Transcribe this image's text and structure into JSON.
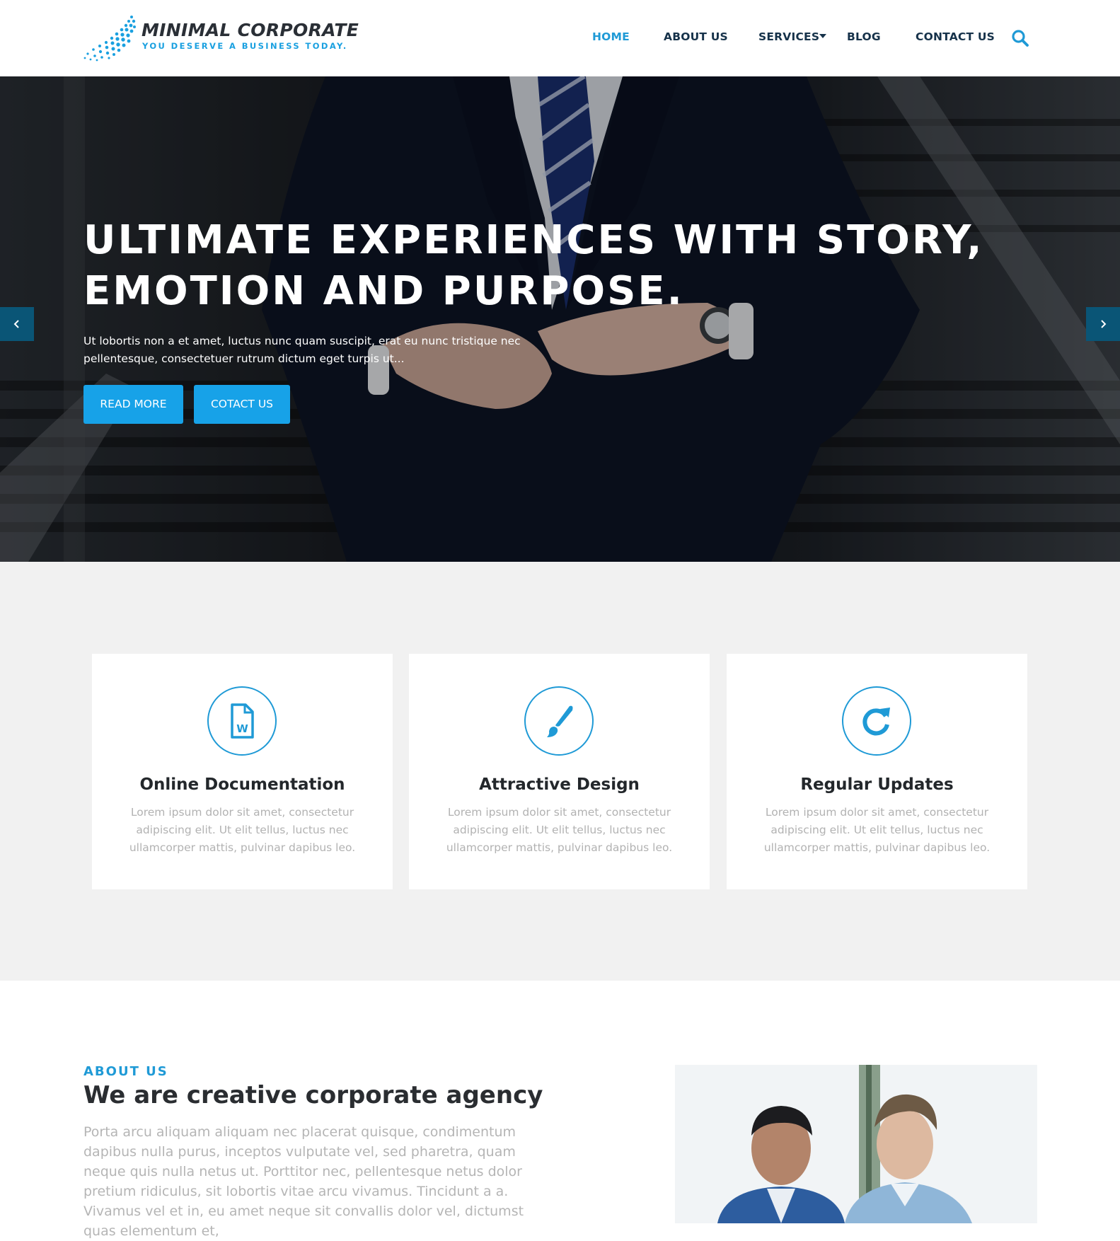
{
  "brand": {
    "title": "MINIMAL CORPORATE",
    "tagline": "YOU DESERVE A BUSINESS TODAY.",
    "accent_color": "#1f9ad6"
  },
  "nav": {
    "items": [
      {
        "label": "HOME",
        "active": true
      },
      {
        "label": "ABOUT US",
        "active": false
      },
      {
        "label": "SERVICES",
        "active": false,
        "has_dropdown": true
      },
      {
        "label": "BLOG",
        "active": false
      },
      {
        "label": "CONTACT US",
        "active": false
      }
    ],
    "search_icon": "search-icon"
  },
  "hero": {
    "title_line1": "ULTIMATE EXPERIENCES WITH STORY,",
    "title_line2": "EMOTION AND PURPOSE.",
    "subtitle": "Ut lobortis non a et amet, luctus nunc quam suscipit, erat eu nunc tristique nec pellentesque, consectetuer rutrum dictum eget turpis ut...",
    "buttons": [
      {
        "label": "READ MORE"
      },
      {
        "label": "COTACT US"
      }
    ],
    "prev_icon": "chevron-left-icon",
    "next_icon": "chevron-right-icon",
    "button_color": "#17a2e8",
    "arrow_color": "#0a5576"
  },
  "features": [
    {
      "icon": "word-document-icon",
      "title": "Online Documentation",
      "text": "Lorem ipsum dolor sit amet, consectetur adipiscing elit. Ut elit tellus, luctus nec ullamcorper mattis, pulvinar dapibus leo."
    },
    {
      "icon": "paint-brush-icon",
      "title": "Attractive Design",
      "text": "Lorem ipsum dolor sit amet, consectetur adipiscing elit. Ut elit tellus, luctus nec ullamcorper mattis, pulvinar dapibus leo."
    },
    {
      "icon": "refresh-icon",
      "title": "Regular Updates",
      "text": "Lorem ipsum dolor sit amet, consectetur adipiscing elit. Ut elit tellus, luctus nec ullamcorper mattis, pulvinar dapibus leo."
    }
  ],
  "about": {
    "kicker": "ABOUT US",
    "title": "We are creative corporate agency",
    "text": "Porta arcu aliquam aliquam nec placerat quisque, condimentum dapibus nulla purus, inceptos vulputate vel, sed pharetra, quam neque quis nulla netus ut. Porttitor nec, pellentesque netus dolor pretium ridiculus, sit lobortis vitae arcu vivamus. Tincidunt a a. Vivamus vel et in, eu amet neque sit convallis dolor vel, dictumst quas elementum et,"
  }
}
